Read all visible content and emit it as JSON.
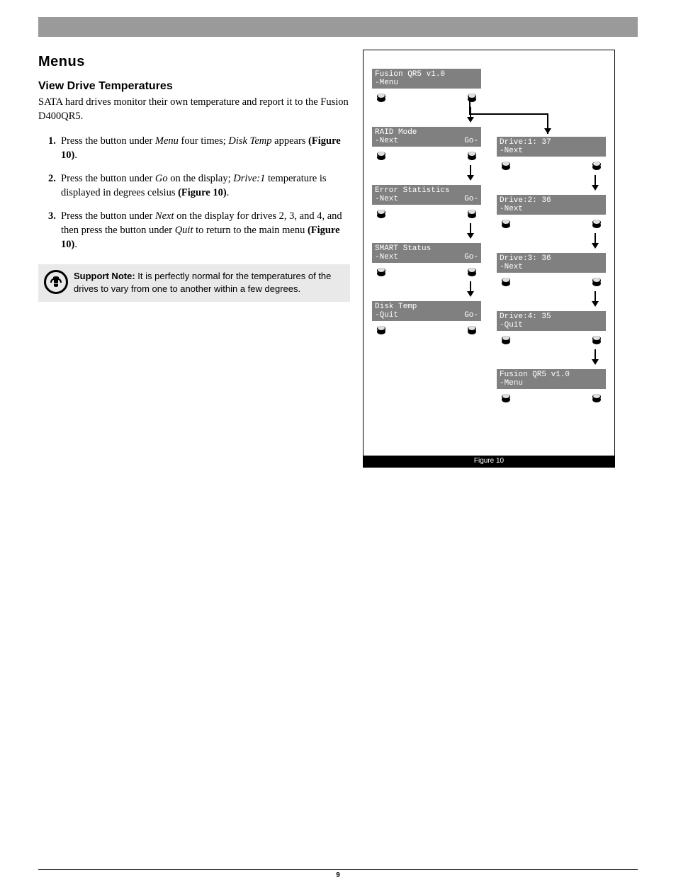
{
  "heading": "Menus",
  "subheading": "View Drive Temperatures",
  "intro": "SATA hard drives monitor their own temperature and report it to the Fusion D400QR5.",
  "steps": [
    {
      "num": "1.",
      "pre": "Press the button under ",
      "ital1": "Menu",
      "mid": " four times; ",
      "ital2": "Disk Temp",
      "post": " appears ",
      "fig": "(Figure 10)",
      "tail": "."
    },
    {
      "num": "2.",
      "pre": "Press the button under ",
      "ital1": "Go",
      "mid": " on the display; ",
      "ital2": "Drive:1",
      "post": " temperature is displayed in degrees celsius ",
      "fig": "(Figure 10)",
      "tail": "."
    },
    {
      "num": "3.",
      "pre": "Press the button under ",
      "ital1": "Next",
      "mid": " on the display for drives 2, 3, and 4, and then press the button under ",
      "ital2": "Quit",
      "post": " to return to the main menu ",
      "fig": "(Figure 10)",
      "tail": "."
    }
  ],
  "note_label": "Support Note:",
  "note_text": " It is perfectly normal for the temperatures of the drives to vary from one to another within a few degrees.",
  "figure_caption": "Figure 10",
  "page_number": "9",
  "lcd_col1": [
    {
      "l1l": "Fusion QR5 v1.0",
      "l1r": "",
      "l2l": "-Menu",
      "l2r": ""
    },
    {
      "l1l": "RAID Mode",
      "l1r": "",
      "l2l": "-Next",
      "l2r": "Go-"
    },
    {
      "l1l": "Error Statistics",
      "l1r": "",
      "l2l": "-Next",
      "l2r": "Go-"
    },
    {
      "l1l": "SMART Status",
      "l1r": "",
      "l2l": "-Next",
      "l2r": "Go-"
    },
    {
      "l1l": "Disk Temp",
      "l1r": "",
      "l2l": "-Quit",
      "l2r": "Go-"
    }
  ],
  "lcd_col2": [
    {
      "l1l": "Drive:1: 37",
      "l1r": "",
      "l2l": "-Next",
      "l2r": ""
    },
    {
      "l1l": "Drive:2: 36",
      "l1r": "",
      "l2l": "-Next",
      "l2r": ""
    },
    {
      "l1l": "Drive:3: 36",
      "l1r": "",
      "l2l": "-Next",
      "l2r": ""
    },
    {
      "l1l": "Drive:4: 35",
      "l1r": "",
      "l2l": "-Quit",
      "l2r": ""
    },
    {
      "l1l": "Fusion QR5 v1.0",
      "l1r": "",
      "l2l": "-Menu",
      "l2r": ""
    }
  ]
}
